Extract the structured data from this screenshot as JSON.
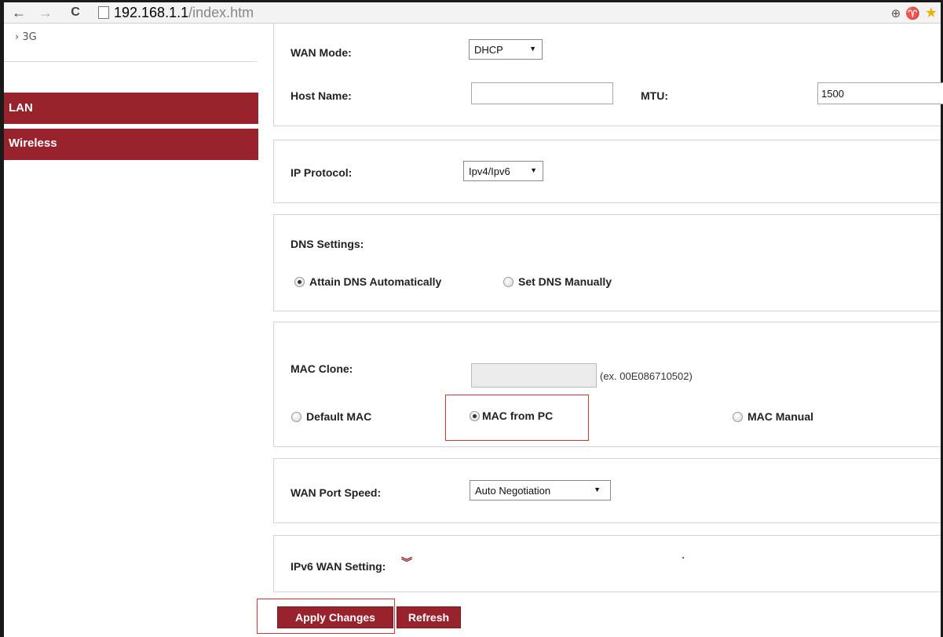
{
  "browser": {
    "url_host": "192.168.1.1",
    "url_path": "/index.htm",
    "back_glyph": "←",
    "forward_glyph": "→",
    "reload_glyph": "C"
  },
  "sidebar": {
    "section_3g": "› 3G",
    "items": [
      {
        "label": "LAN"
      },
      {
        "label": "Wireless"
      }
    ]
  },
  "wan": {
    "mode_label": "WAN Mode:",
    "mode_value": "DHCP",
    "host_label": "Host Name:",
    "host_value": "",
    "mtu_label": "MTU:",
    "mtu_value": "1500"
  },
  "ip": {
    "label": "IP Protocol:",
    "value": "Ipv4/Ipv6"
  },
  "dns": {
    "label": "DNS Settings:",
    "options": [
      {
        "label": "Attain DNS Automatically",
        "selected": true
      },
      {
        "label": "Set DNS Manually",
        "selected": false
      }
    ]
  },
  "mac": {
    "label": "MAC Clone:",
    "value": "",
    "hint": "(ex. 00E086710502)",
    "options": [
      {
        "label": "Default MAC",
        "selected": false
      },
      {
        "label": "MAC from PC",
        "selected": true
      },
      {
        "label": "MAC Manual",
        "selected": false
      }
    ]
  },
  "port": {
    "label": "WAN Port Speed:",
    "value": "Auto Negotiation"
  },
  "ipv6": {
    "label": "IPv6 WAN Setting:"
  },
  "buttons": {
    "apply": "Apply Changes",
    "refresh": "Refresh"
  },
  "colors": {
    "accent": "#98232c",
    "highlight": "#e03030"
  }
}
